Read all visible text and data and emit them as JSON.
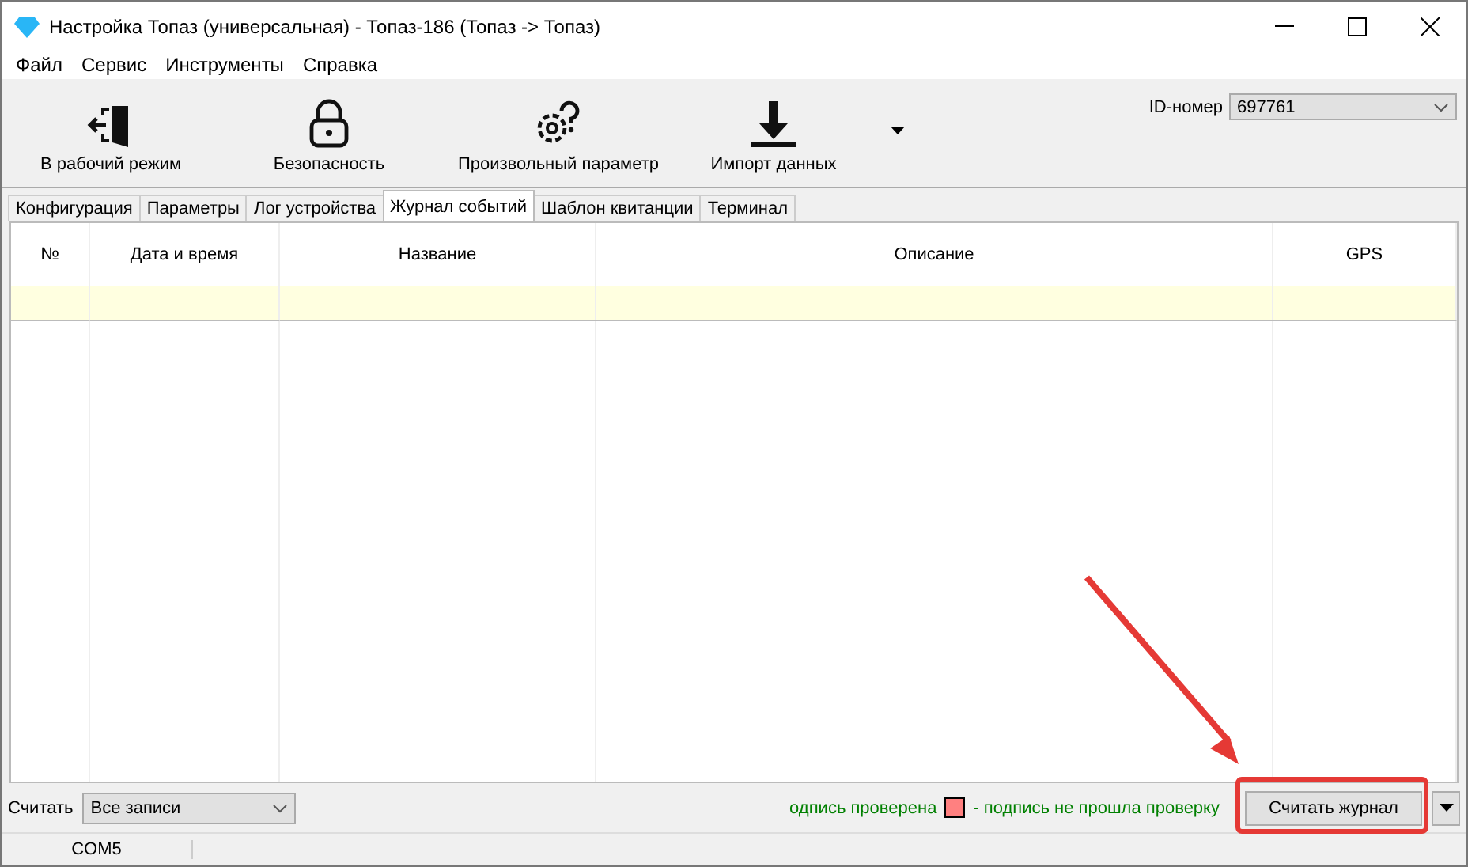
{
  "window": {
    "title": "Настройка Топаз (универсальная) - Топаз-186 (Топаз -> Топаз)"
  },
  "menu": [
    "Файл",
    "Сервис",
    "Инструменты",
    "Справка"
  ],
  "toolbar": {
    "buttons": [
      {
        "label": "В рабочий режим",
        "kind": "exit"
      },
      {
        "label": "Безопасность",
        "kind": "lock"
      },
      {
        "label": "Произвольный параметр",
        "kind": "gear"
      },
      {
        "label": "Импорт данных",
        "kind": "download"
      }
    ],
    "id_label": "ID-номер",
    "id_value": "697761"
  },
  "tabs": [
    {
      "label": "Конфигурация",
      "selected": false
    },
    {
      "label": "Параметры",
      "selected": false
    },
    {
      "label": "Лог устройства",
      "selected": false
    },
    {
      "label": "Журнал событий",
      "selected": true
    },
    {
      "label": "Шаблон квитанции",
      "selected": false
    },
    {
      "label": "Терминал",
      "selected": false
    }
  ],
  "table": {
    "columns": [
      "№",
      "Дата и время",
      "Название",
      "Описание",
      "GPS"
    ]
  },
  "footer": {
    "read_label": "Считать",
    "read_mode": "Все записи",
    "legend": [
      {
        "text": "одпись проверена"
      },
      {
        "text": "- подпись не прошла проверку",
        "color": "#ff8080"
      }
    ],
    "read_button": "Считать журнал"
  },
  "status_bar": [
    "COM5"
  ]
}
